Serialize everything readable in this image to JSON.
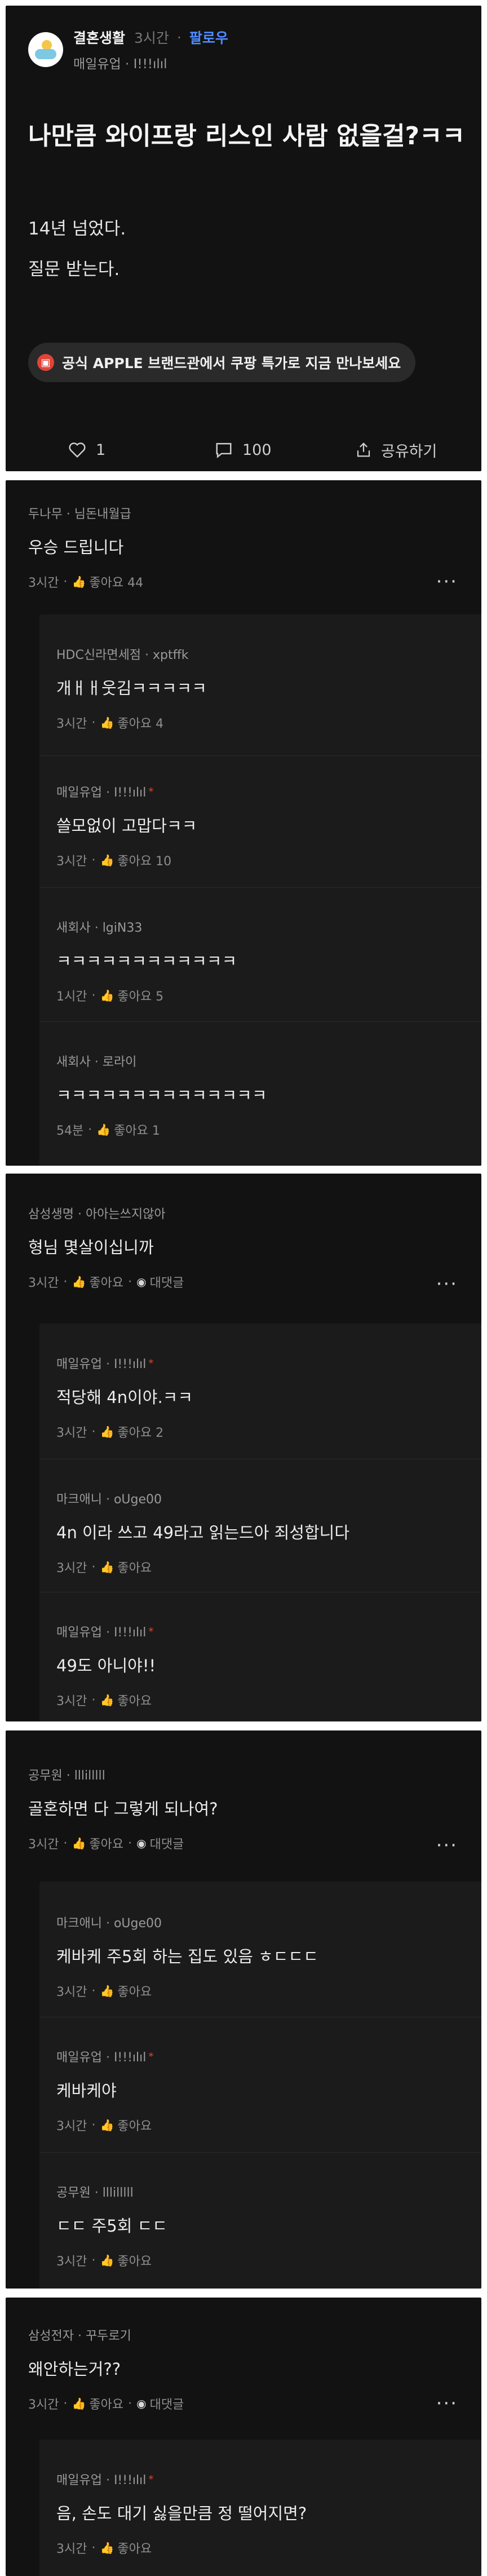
{
  "post": {
    "community": "결혼생활",
    "time": "3시간",
    "follow": "팔로우",
    "author": "매일유업 · I!!!ılıl",
    "title": "나만큼 와이프랑 리스인 사람 없을걸?ㅋㅋ",
    "body_lines": [
      "14년 넘었다.",
      "질문 받는다."
    ],
    "ad_text": "공식 APPLE 브랜드관에서 쿠팡 특가로 지금 만나보세요",
    "likes": "1",
    "comments": "100",
    "share": "공유하기"
  },
  "threads": [
    {
      "author": "두나무 · 님돈내월급",
      "text": "우승 드립니다",
      "time": "3시간",
      "like": "좋아요 44",
      "replies": [
        {
          "author": "HDC신라면세점 · xptffk",
          "text": "개ㅐㅐ웃김ㅋㅋㅋㅋㅋ",
          "time": "3시간",
          "like": "좋아요 4",
          "red": false
        },
        {
          "author": "매일유업 · I!!!ılıl",
          "text": "쓸모없이 고맙다ㅋㅋ",
          "time": "3시간",
          "like": "좋아요 10",
          "red": true
        },
        {
          "author": "새회사 · lgiN33",
          "text": "ㅋㅋㅋㅋㅋㅋㅋㅋㅋㅋㅋㅋ",
          "time": "1시간",
          "like": "좋아요 5",
          "red": false
        },
        {
          "author": "새회사 · 로라이",
          "text": "ㅋㅋㅋㅋㅋㅋㅋㅋㅋㅋㅋㅋㅋㅋ",
          "time": "54분",
          "like": "좋아요 1",
          "red": false
        }
      ]
    },
    {
      "author": "삼성생명 · 아아는쓰지않아",
      "text": "형님 몇살이십니까",
      "time": "3시간",
      "like": "좋아요",
      "reply_label": "대댓글",
      "replies": [
        {
          "author": "매일유업 · I!!!ılıl",
          "text": "적당해 4n이야.ㅋㅋ",
          "time": "3시간",
          "like": "좋아요 2",
          "red": true
        },
        {
          "author": "마크애니 · oUge00",
          "text": "4n 이라 쓰고 49라고 읽는드아 죄성합니다",
          "time": "3시간",
          "like": "좋아요",
          "red": false
        },
        {
          "author": "매일유업 · I!!!ılıl",
          "text": "49도 아니야!!",
          "time": "3시간",
          "like": "좋아요",
          "red": true
        }
      ]
    },
    {
      "author": "공무원 · lllilllll",
      "text": "골혼하면 다 그렇게 되나여?",
      "time": "3시간",
      "like": "좋아요",
      "reply_label": "대댓글",
      "replies": [
        {
          "author": "마크애니 · oUge00",
          "text": "케바케 주5회 하는 집도 있음 ㅎㄷㄷㄷ",
          "time": "3시간",
          "like": "좋아요",
          "red": false
        },
        {
          "author": "매일유업 · I!!!ılıl",
          "text": "케바케야",
          "time": "3시간",
          "like": "좋아요",
          "red": true
        },
        {
          "author": "공무원 · lllilllll",
          "text": "ㄷㄷ 주5회 ㄷㄷ",
          "time": "3시간",
          "like": "좋아요",
          "red": false
        }
      ]
    },
    {
      "author": "삼성전자 · 꾸두로기",
      "text": "왜안하는거??",
      "time": "3시간",
      "like": "좋아요",
      "reply_label": "대댓글",
      "replies": [
        {
          "author": "매일유업 · I!!!ılıl",
          "text": "음, 손도 대기 싫을만큼 정 떨어지면?",
          "time": "3시간",
          "like": "좋아요",
          "red": true
        }
      ]
    }
  ],
  "colors": {
    "background": "#121212",
    "accent": "#4f8cff",
    "badge": "#e0453a"
  }
}
